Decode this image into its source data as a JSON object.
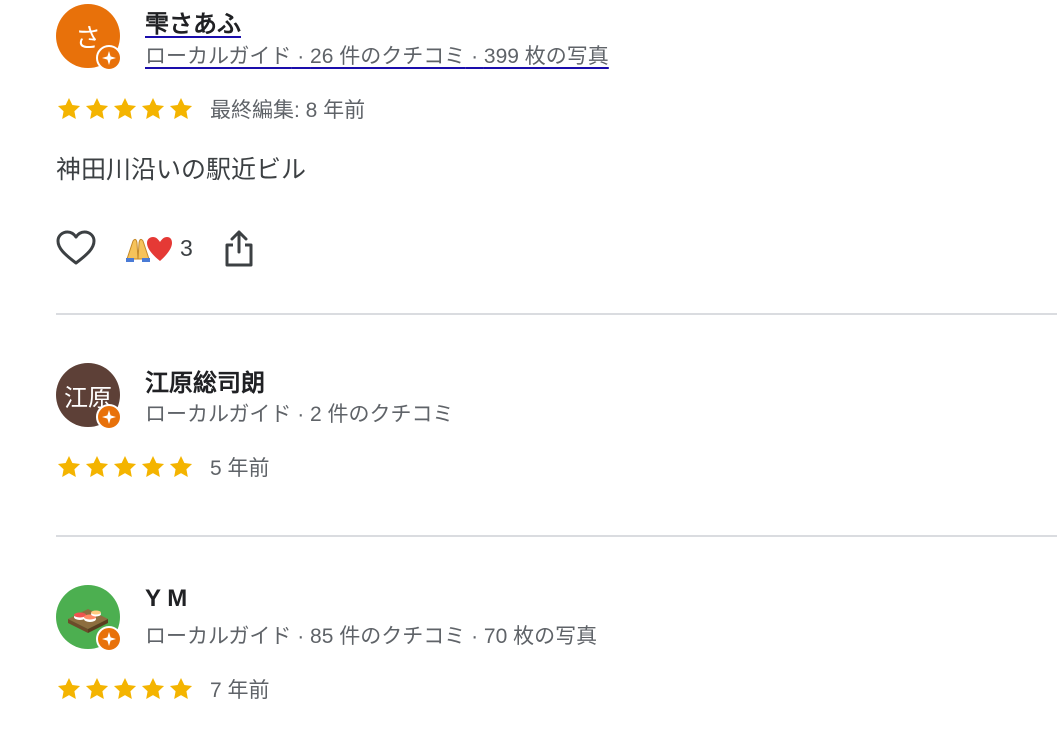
{
  "reviews": [
    {
      "avatar_initial": "さ",
      "avatar_color": "#e8710a",
      "name": "雫さあふ",
      "meta": {
        "guide": "ローカルガイド",
        "sep1": " · ",
        "reviews": "26 件のクチコミ",
        "sep2": " · ",
        "photos": "399 枚の写真"
      },
      "rating": 5,
      "time": "最終編集: 8 年前",
      "text": "神田川沿いの駅近ビル",
      "reaction_count": "3"
    },
    {
      "avatar_initial": "江原",
      "avatar_color": "#5d4037",
      "name": "江原総司朗",
      "meta": {
        "guide": "ローカルガイド",
        "sep1": " · ",
        "reviews": "2 件のクチコミ"
      },
      "rating": 5,
      "time": "5 年前"
    },
    {
      "avatar_initial": "",
      "avatar_color": "#4caf50",
      "name": "Y M",
      "meta": {
        "guide": "ローカルガイド",
        "sep1": " · ",
        "reviews": "85 件のクチコミ",
        "sep2": " · ",
        "photos": "70 枚の写真"
      },
      "rating": 5,
      "time": "7 年前"
    }
  ],
  "colors": {
    "star": "#f4b400",
    "badge": "#e8710a",
    "link_underline": "#1a0dab"
  },
  "icons": {
    "like": "heart-outline-icon",
    "share": "share-icon",
    "reaction": "pray-heart-emoji",
    "badge": "local-guide-badge-icon"
  }
}
